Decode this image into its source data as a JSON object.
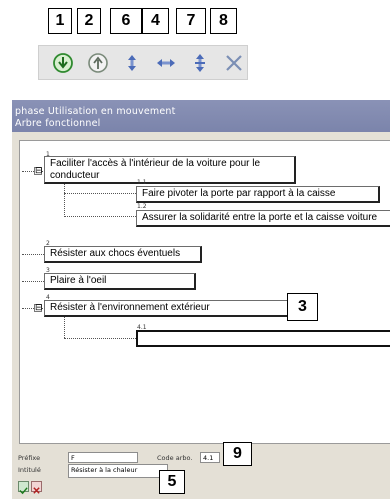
{
  "callouts": {
    "c1": "1",
    "c2": "2",
    "c6": "6",
    "c4": "4",
    "c7": "7",
    "c8": "8",
    "c3": "3",
    "c9": "9",
    "c5": "5"
  },
  "toolbar": {
    "buttons": [
      "move-down-icon",
      "move-up-icon",
      "move-vertical-icon",
      "move-horizontal-icon",
      "swap-vertical-icon",
      "delete-icon"
    ],
    "colors": {
      "green": "#2f8a2f",
      "blue": "#4b6bb8",
      "red_x": "#7b8fb5"
    }
  },
  "window": {
    "header": {
      "line1": "phase  Utilisation en mouvement",
      "line2": "Arbre fonctionnel"
    },
    "nodes": [
      {
        "num": "1",
        "label_line1": "Faciliter l'accès à l'intérieur de la voiture pour le",
        "label_line2": "conducteur"
      },
      {
        "num": "1.1",
        "label": "Faire pivoter la porte par rapport à la caisse"
      },
      {
        "num": "1.2",
        "label": "Assurer la solidarité entre la porte et la caisse voiture"
      },
      {
        "num": "2",
        "label": "Résister aux chocs éventuels"
      },
      {
        "num": "3",
        "label": "Plaire à l'oeil"
      },
      {
        "num": "4",
        "label": "Résister à l'environnement extérieur"
      },
      {
        "num": "4.1",
        "label": ""
      }
    ],
    "expander_symbol": "⊟",
    "form": {
      "prefix_label": "Préfixe",
      "prefix_value": "F",
      "code_label": "Code arbo.",
      "code_value": "4.1",
      "title_label": "Intitulé",
      "title_value": "Résister à la chaleur"
    }
  }
}
